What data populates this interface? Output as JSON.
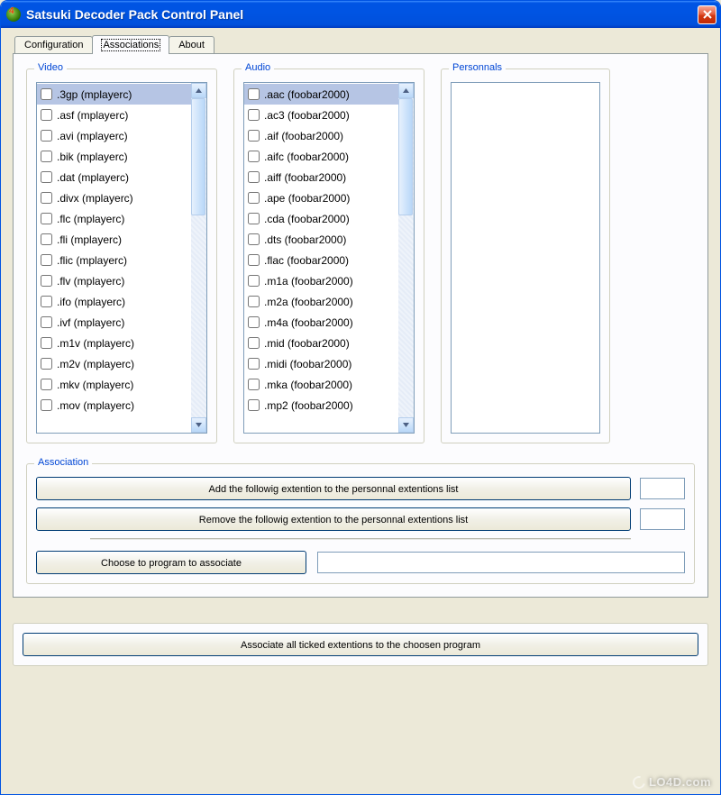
{
  "window": {
    "title": "Satsuki Decoder Pack Control Panel"
  },
  "tabs": [
    {
      "label": "Configuration"
    },
    {
      "label": "Associations"
    },
    {
      "label": "About"
    }
  ],
  "active_tab": 1,
  "video": {
    "legend": "Video",
    "items": [
      {
        "label": ".3gp (mplayerc)",
        "selected": true
      },
      {
        "label": ".asf (mplayerc)"
      },
      {
        "label": ".avi (mplayerc)"
      },
      {
        "label": ".bik (mplayerc)"
      },
      {
        "label": ".dat (mplayerc)"
      },
      {
        "label": ".divx (mplayerc)"
      },
      {
        "label": ".flc (mplayerc)"
      },
      {
        "label": ".fli (mplayerc)"
      },
      {
        "label": ".flic (mplayerc)"
      },
      {
        "label": ".flv (mplayerc)"
      },
      {
        "label": ".ifo (mplayerc)"
      },
      {
        "label": ".ivf (mplayerc)"
      },
      {
        "label": ".m1v (mplayerc)"
      },
      {
        "label": ".m2v (mplayerc)"
      },
      {
        "label": ".mkv (mplayerc)"
      },
      {
        "label": ".mov (mplayerc)"
      }
    ]
  },
  "audio": {
    "legend": "Audio",
    "items": [
      {
        "label": ".aac (foobar2000)",
        "selected": true
      },
      {
        "label": ".ac3 (foobar2000)"
      },
      {
        "label": ".aif (foobar2000)"
      },
      {
        "label": ".aifc (foobar2000)"
      },
      {
        "label": ".aiff (foobar2000)"
      },
      {
        "label": ".ape (foobar2000)"
      },
      {
        "label": ".cda (foobar2000)"
      },
      {
        "label": ".dts (foobar2000)"
      },
      {
        "label": ".flac (foobar2000)"
      },
      {
        "label": ".m1a (foobar2000)"
      },
      {
        "label": ".m2a (foobar2000)"
      },
      {
        "label": ".m4a (foobar2000)"
      },
      {
        "label": ".mid (foobar2000)"
      },
      {
        "label": ".midi (foobar2000)"
      },
      {
        "label": ".mka (foobar2000)"
      },
      {
        "label": ".mp2 (foobar2000)"
      }
    ]
  },
  "personnals": {
    "legend": "Personnals",
    "items": []
  },
  "association": {
    "legend": "Association",
    "add_btn": "Add the followig extention to the personnal extentions list",
    "remove_btn": "Remove the followig extention to the personnal extentions list",
    "add_value": "",
    "remove_value": "",
    "choose_btn": "Choose to program to associate",
    "program_path": ""
  },
  "bottom": {
    "associate_all_btn": "Associate all ticked extentions to the choosen program"
  },
  "watermark": "LO4D.com"
}
